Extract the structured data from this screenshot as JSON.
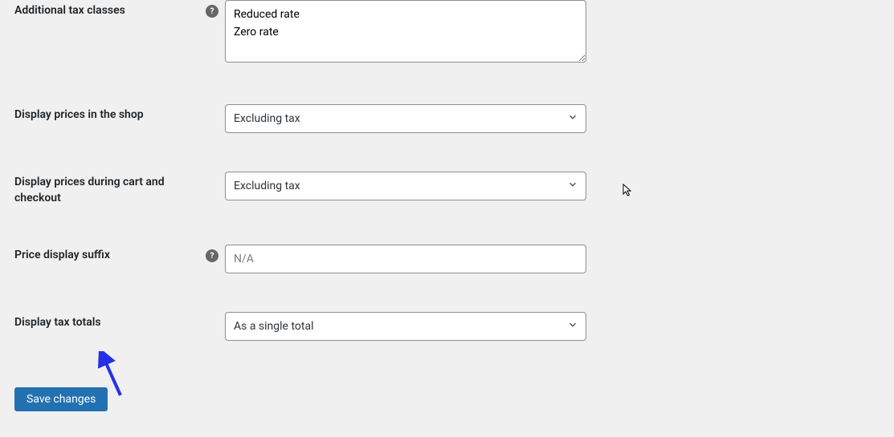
{
  "fields": {
    "additional_tax_classes": {
      "label": "Additional tax classes",
      "value": "Reduced rate\nZero rate",
      "has_help": true
    },
    "display_prices_shop": {
      "label": "Display prices in the shop",
      "value": "Excluding tax",
      "has_help": false
    },
    "display_prices_cart": {
      "label": "Display prices during cart and checkout",
      "value": "Excluding tax",
      "has_help": false
    },
    "price_display_suffix": {
      "label": "Price display suffix",
      "placeholder": "N/A",
      "value": "",
      "has_help": true
    },
    "display_tax_totals": {
      "label": "Display tax totals",
      "value": "As a single total",
      "has_help": false
    }
  },
  "buttons": {
    "save": "Save changes"
  },
  "icons": {
    "help": "?"
  }
}
